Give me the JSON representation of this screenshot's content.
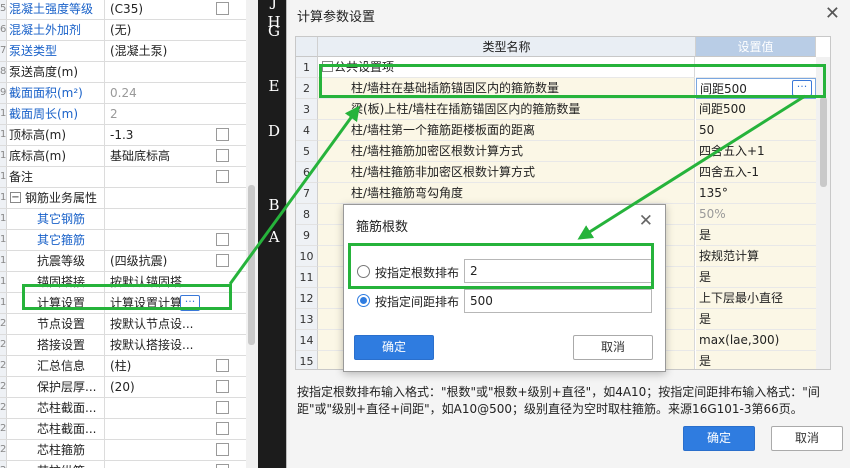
{
  "left_panel": {
    "rows": [
      {
        "num": "5",
        "name": "混凝土强度等级",
        "value": "(C35)",
        "blue": true,
        "check": true
      },
      {
        "num": "6",
        "name": "混凝土外加剂",
        "value": "(无)",
        "blue": true,
        "check": false
      },
      {
        "num": "7",
        "name": "泵送类型",
        "value": "(混凝土泵)",
        "blue": true,
        "check": false
      },
      {
        "num": "8",
        "name": "泵送高度(m)",
        "value": "",
        "blue": false,
        "check": false
      },
      {
        "num": "9",
        "name": "截面面积(m²)",
        "value": "0.24",
        "blue": true,
        "check": false,
        "gray": true
      },
      {
        "num": "10",
        "name": "截面周长(m)",
        "value": "2",
        "blue": true,
        "check": false,
        "gray": true
      },
      {
        "num": "11",
        "name": "顶标高(m)",
        "value": "-1.3",
        "blue": false,
        "check": true
      },
      {
        "num": "12",
        "name": "底标高(m)",
        "value": "基础底标高",
        "blue": false,
        "check": true
      },
      {
        "num": "13",
        "name": "备注",
        "value": "",
        "blue": false,
        "check": true
      },
      {
        "num": "14",
        "name": "钢筋业务属性",
        "value": "",
        "blue": false,
        "check": false,
        "group": true
      },
      {
        "num": "15",
        "name": "其它钢筋",
        "value": "",
        "blue": true,
        "check": false,
        "indent": true
      },
      {
        "num": "16",
        "name": "其它箍筋",
        "value": "",
        "blue": true,
        "check": true,
        "indent": true
      },
      {
        "num": "17",
        "name": "抗震等级",
        "value": "(四级抗震)",
        "blue": false,
        "check": true,
        "indent": true
      },
      {
        "num": "18",
        "name": "锚固搭接",
        "value": "按默认锚固搭...",
        "blue": false,
        "check": false,
        "indent": true
      },
      {
        "num": "19",
        "name": "计算设置",
        "value": "计算设置计算",
        "blue": false,
        "check": false,
        "indent": true,
        "ellipsis": true
      },
      {
        "num": "20",
        "name": "节点设置",
        "value": "按默认节点设...",
        "blue": false,
        "check": false,
        "indent": true
      },
      {
        "num": "21",
        "name": "搭接设置",
        "value": "按默认搭接设...",
        "blue": false,
        "check": false,
        "indent": true
      },
      {
        "num": "22",
        "name": "汇总信息",
        "value": "(柱)",
        "blue": false,
        "check": true,
        "indent": true
      },
      {
        "num": "23",
        "name": "保护层厚...",
        "value": "(20)",
        "blue": false,
        "check": true,
        "indent": true
      },
      {
        "num": "24",
        "name": "芯柱截面...",
        "value": "",
        "blue": false,
        "check": true,
        "indent": true
      },
      {
        "num": "25",
        "name": "芯柱截面...",
        "value": "",
        "blue": false,
        "check": true,
        "indent": true
      },
      {
        "num": "26",
        "name": "芯柱箍筋",
        "value": "",
        "blue": false,
        "check": true,
        "indent": true
      },
      {
        "num": "27",
        "name": "芯柱纵筋",
        "value": "",
        "blue": false,
        "check": true,
        "indent": true
      }
    ]
  },
  "sidebar_letters": [
    "J",
    "H",
    "G",
    "E",
    "D",
    "B",
    "A"
  ],
  "main_dialog": {
    "title": "计算参数设置",
    "close": "✕",
    "col_name": "类型名称",
    "col_value": "设置值",
    "rows": [
      {
        "num": "1",
        "name": "公共设置项",
        "value": "",
        "group": true
      },
      {
        "num": "2",
        "name": "柱/墙柱在基础插筋锚固区内的箍筋数量",
        "value": "间距500",
        "editing": true
      },
      {
        "num": "3",
        "name": "梁(板)上柱/墙柱在插筋锚固区内的箍筋数量",
        "value": "间距500"
      },
      {
        "num": "4",
        "name": "柱/墙柱第一个箍筋距楼板面的距离",
        "value": "50"
      },
      {
        "num": "5",
        "name": "柱/墙柱箍筋加密区根数计算方式",
        "value": "四舍五入+1"
      },
      {
        "num": "6",
        "name": "柱/墙柱箍筋非加密区根数计算方式",
        "value": "四舍五入-1"
      },
      {
        "num": "7",
        "name": "柱/墙柱箍筋弯勾角度",
        "value": "135°"
      },
      {
        "num": "8",
        "name": "",
        "value": "50%",
        "gray": true
      },
      {
        "num": "9",
        "name": "",
        "value": "是"
      },
      {
        "num": "10",
        "name": "",
        "value": "按规范计算"
      },
      {
        "num": "11",
        "name": "",
        "value": "是"
      },
      {
        "num": "12",
        "name": "",
        "value": "上下层最小直径"
      },
      {
        "num": "13",
        "name": "",
        "value": "是"
      },
      {
        "num": "14",
        "name": "",
        "value": "max(lae,300)"
      },
      {
        "num": "15",
        "name": "",
        "value": "是"
      }
    ],
    "help_text": "按指定根数排布输入格式：\"根数\"或\"根数+级别+直径\"，如4A10；按指定间距排布输入格式：\"间距\"或\"级别+直径+间距\"，如A10@500；级别直径为空时取柱箍筋。来源16G101-3第66页。",
    "ok_label": "确定",
    "cancel_label": "取消"
  },
  "popup": {
    "title": "箍筋根数",
    "close": "✕",
    "option1_label": "按指定根数排布",
    "option1_value": "2",
    "option2_label": "按指定间距排布",
    "option2_value": "500",
    "selected": "option2",
    "ok_label": "确定",
    "cancel_label": "取消"
  },
  "colors": {
    "annotation_green": "#26b33b",
    "accent_blue": "#2f7ce0",
    "label_blue": "#1a62c9"
  }
}
